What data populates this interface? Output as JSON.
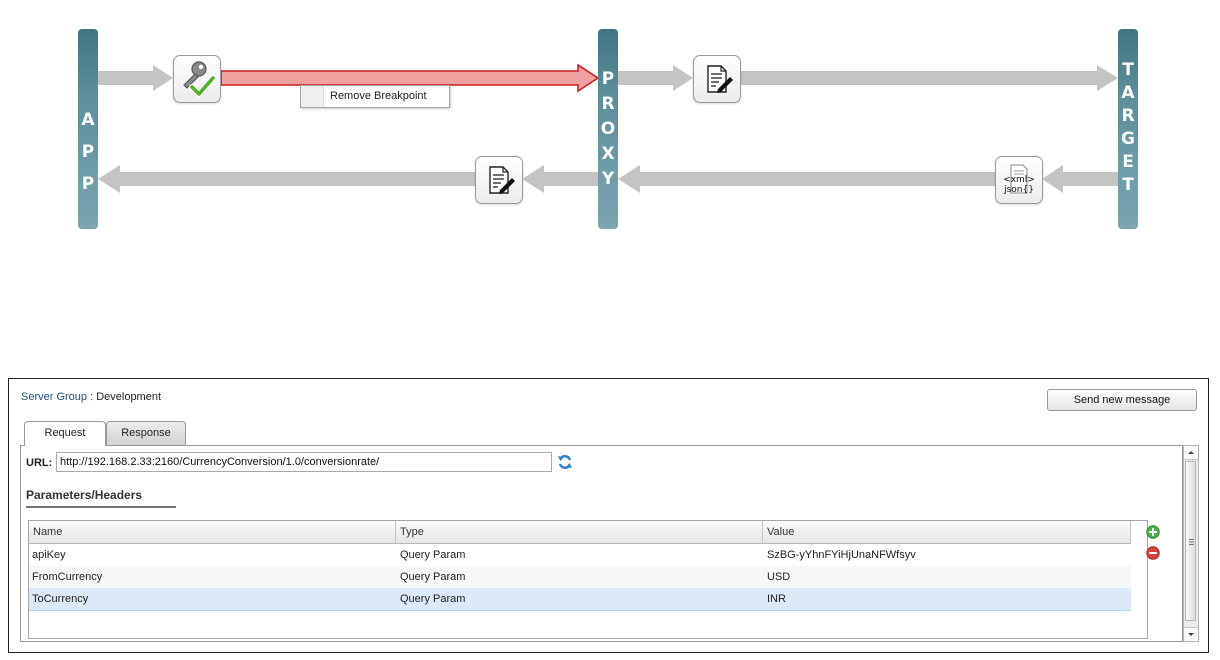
{
  "flow": {
    "pillars": {
      "app": [
        "A",
        "P",
        "P"
      ],
      "proxy": [
        "P",
        "R",
        "O",
        "X",
        "Y"
      ],
      "target": [
        "T",
        "A",
        "R",
        "G",
        "E",
        "T"
      ]
    },
    "steps": [
      {
        "id": "verify-api-key",
        "icon": "key-check-icon"
      },
      {
        "id": "request-policy",
        "icon": "edit-document-icon"
      },
      {
        "id": "response-policy",
        "icon": "edit-document-icon"
      },
      {
        "id": "xml-to-json",
        "icon": "xml-json-icon",
        "text_top": "<xml>",
        "text_bottom": "json{}"
      }
    ],
    "context_menu": {
      "item": "Remove Breakpoint"
    },
    "colors": {
      "pillar": "#4e8492",
      "arrow": "#c4c4c4",
      "breakpoint_fill": "#f2a0a0",
      "breakpoint_stroke": "#cc1f1f"
    }
  },
  "panel": {
    "server_group_label": "Server Group :",
    "server_group_value": "Development",
    "send_button": "Send new message",
    "tabs": [
      {
        "label": "Request",
        "active": true
      },
      {
        "label": "Response",
        "active": false
      }
    ],
    "url_label": "URL:",
    "url_value": "http://192.168.2.33:2160/CurrencyConversion/1.0/conversionrate/",
    "section_title": "Parameters/Headers",
    "grid": {
      "columns": [
        "Name",
        "Type",
        "Value"
      ],
      "rows": [
        {
          "name": "apiKey",
          "type": "Query Param",
          "value": "SzBG-yYhnFYiHjUnaNFWfsyv"
        },
        {
          "name": "FromCurrency",
          "type": "Query Param",
          "value": "USD"
        },
        {
          "name": "ToCurrency",
          "type": "Query Param",
          "value": "INR",
          "selected": true
        }
      ]
    }
  }
}
